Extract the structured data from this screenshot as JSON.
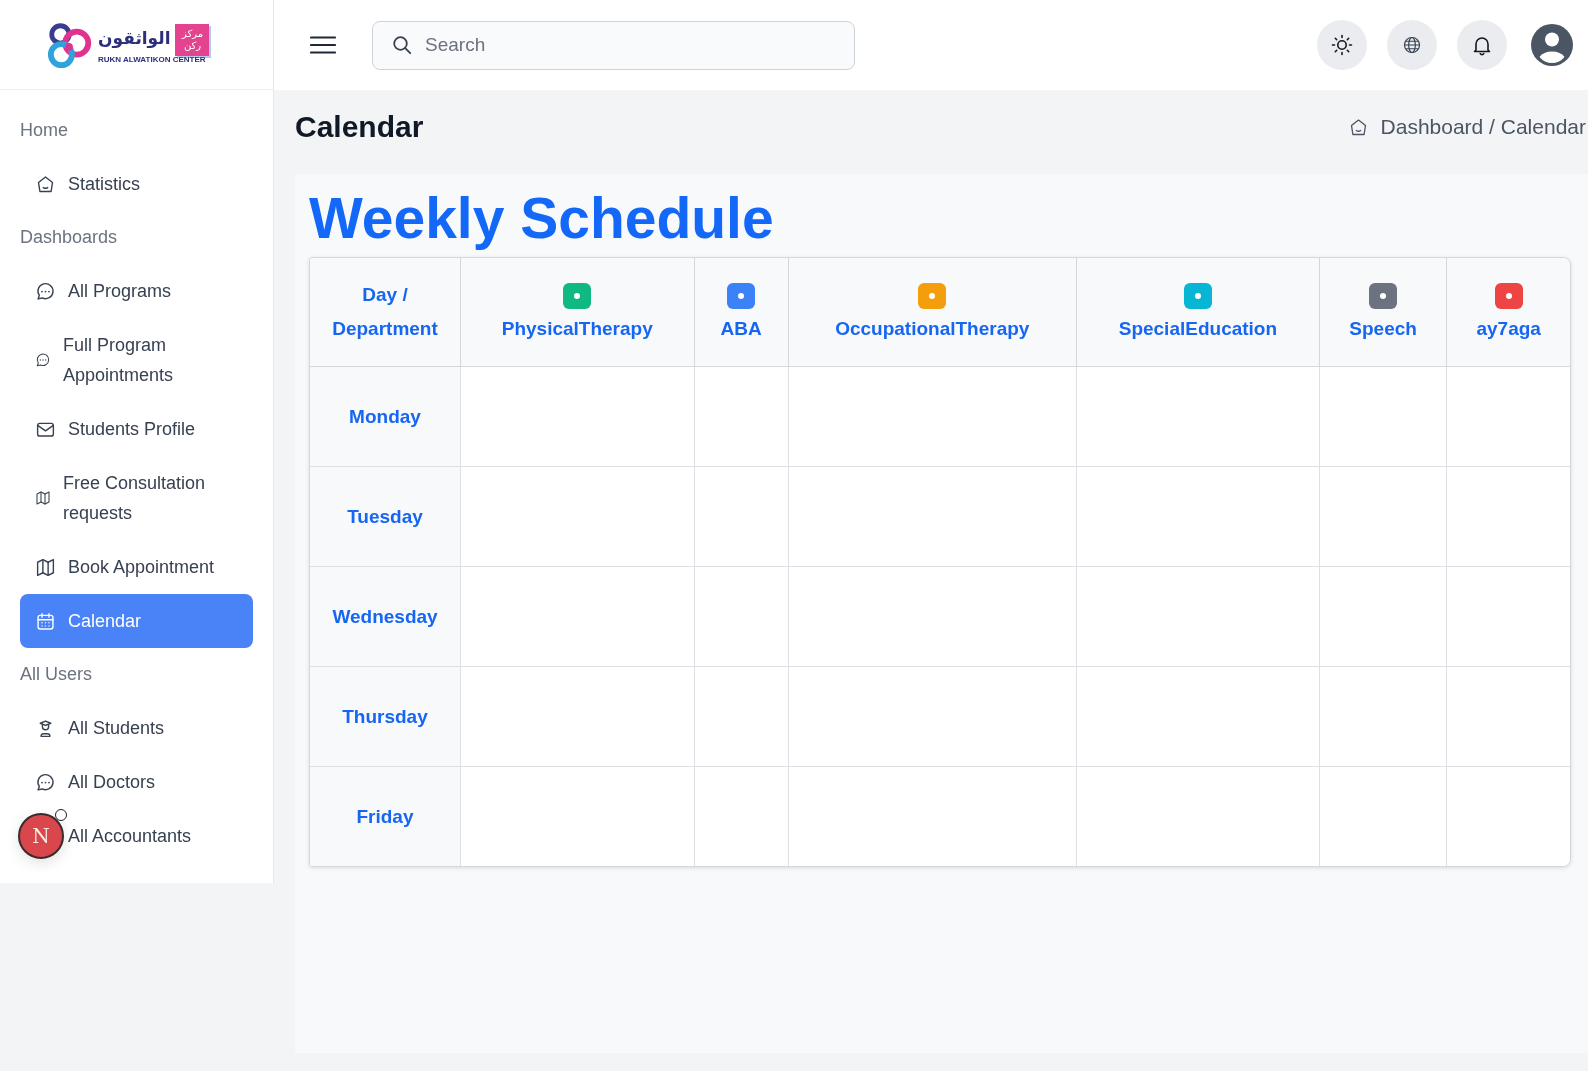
{
  "sidebar": {
    "logo": {
      "title": "الواثقون",
      "emblem": [
        "مركز",
        "ركن"
      ],
      "subtitle": "RUKN ALWATIKON CENTER"
    },
    "sections": [
      {
        "title": "Home",
        "items": [
          {
            "label": "Statistics",
            "selected": false
          }
        ]
      },
      {
        "title": "Dashboards",
        "items": [
          {
            "label": "All Programs",
            "selected": false
          },
          {
            "label": "Full Program Appointments",
            "selected": false
          },
          {
            "label": "Students Profile",
            "selected": false
          },
          {
            "label": "Free Consultation requests",
            "selected": false
          },
          {
            "label": "Book Appointment",
            "selected": false
          },
          {
            "label": "Calendar",
            "selected": true
          }
        ]
      },
      {
        "title": "All Users",
        "items": [
          {
            "label": "All Students",
            "selected": false
          },
          {
            "label": "All Doctors",
            "selected": false
          },
          {
            "label": "All Accountants",
            "selected": false
          }
        ]
      }
    ]
  },
  "topbar": {
    "search": {
      "placeholder": "Search"
    }
  },
  "page": {
    "title": "Calendar",
    "breadcrumb": "Dashboard / Calendar"
  },
  "schedule": {
    "title": "Weekly Schedule",
    "corner": "Day / Department",
    "departments": [
      {
        "label": "PhysicalTherapy",
        "color": "#10b981"
      },
      {
        "label": "ABA",
        "color": "#3b82f6"
      },
      {
        "label": "OccupationalTherapy",
        "color": "#f59e0b"
      },
      {
        "label": "SpecialEducation",
        "color": "#06b6d4"
      },
      {
        "label": "Speech",
        "color": "#6b7280"
      },
      {
        "label": "ay7aga",
        "color": "#ef4444"
      }
    ],
    "days": [
      "Monday",
      "Tuesday",
      "Wednesday",
      "Thursday",
      "Friday"
    ]
  },
  "dev_indicator": {
    "label": "N"
  }
}
